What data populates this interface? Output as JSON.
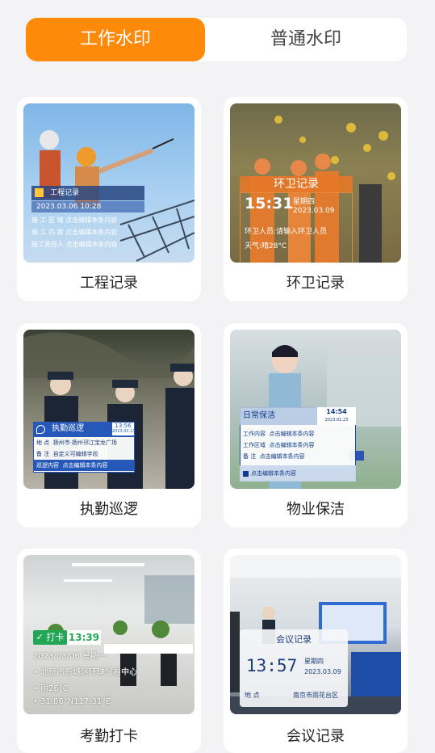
{
  "tabs": {
    "work": "工作水印",
    "normal": "普通水印"
  },
  "cards": [
    {
      "label": "工程记录",
      "overlay": {
        "title": "工程记录",
        "datetime": "2023.03.06  10:28",
        "rows": [
          "施 工 区 域  点击编辑本条内容",
          "施 工 内 容  点击编辑本条内容",
          "施工责任人  点击编辑本条内容"
        ]
      }
    },
    {
      "label": "环卫记录",
      "overlay": {
        "title": "环卫记录",
        "time": "15:31",
        "weekday": "星期四",
        "date": "2023.03.09",
        "person": "环卫人员:请输入环卫人员",
        "weather": "天气:晴28°C"
      }
    },
    {
      "label": "执勤巡逻",
      "overlay": {
        "title": "执勤巡逻",
        "time": "13:56",
        "date": "2023.02.23",
        "rows": [
          {
            "k": "地  点",
            "v": "扬州市·扬州邗江宝龙广场"
          },
          {
            "k": "备  注",
            "v": "自定义可编辑字段"
          },
          {
            "k": "巡逻内容",
            "v": "点击编辑本条内容"
          }
        ]
      }
    },
    {
      "label": "物业保洁",
      "overlay": {
        "title": "日常保洁",
        "time": "14:54",
        "date": "2023.02.23",
        "rows": [
          {
            "k": "工作内容",
            "v": "点击编辑本条内容"
          },
          {
            "k": "工作区域",
            "v": "点击编辑本条内容"
          },
          {
            "k": "备  注",
            "v": "点击编辑本条内容"
          }
        ],
        "footer": "点击编辑本条内容"
      }
    },
    {
      "label": "考勤打卡",
      "overlay": {
        "badge": "打卡",
        "time": "13:39",
        "date": "2023/03/06  星期一",
        "location": "北京市东城区环球贸易中心",
        "weather": "阴26°C",
        "coords": "31.86°N117.31°E"
      }
    },
    {
      "label": "会议记录",
      "overlay": {
        "title": "会议记录",
        "time": "13:57",
        "weekday": "星期四",
        "date": "2023.03.09",
        "loc_k": "地    点",
        "loc_v": "南京市雨花台区"
      }
    }
  ],
  "colors": {
    "accent": "#ff8a0a"
  }
}
